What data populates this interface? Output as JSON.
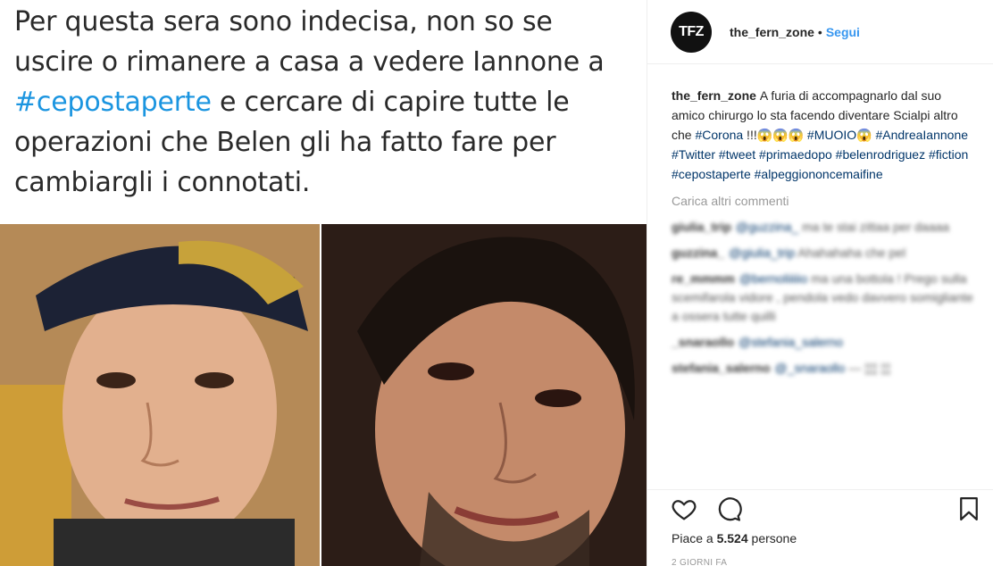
{
  "tweet": {
    "line1": "Per questa sera sono indecisa, non so se",
    "line2": "uscire o rimanere a casa a vedere Iannone a",
    "hashtag": "#cepostaperte",
    "line3_rest": " e cercare di capire tutte le",
    "line4": "operazioni che Belen gli ha fatto fare per",
    "line5": "cambiargli i connotati."
  },
  "header": {
    "avatar_text": "TFZ",
    "username": "the_fern_zone",
    "separator": "•",
    "follow_label": "Segui"
  },
  "caption": {
    "user": "the_fern_zone",
    "text1": "A furia di accompagnarlo dal suo amico chirurgo lo sta facendo diventare Scialpi altro che ",
    "tag_corona": "#Corona",
    "text2": " !!!😱😱😱 ",
    "tag_muoio": "#MUOIO",
    "text3": "😱 ",
    "tag_andrea": "#AndreaIannone",
    "tag_twitter": "#Twitter",
    "tag_tweet": "#tweet",
    "tag_primaedopo": "#primaedopo",
    "tag_belen": "#belenrodriguez",
    "tag_fiction": "#fiction",
    "tag_cepostaperte": "#cepostaperte",
    "tag_alpeggio": "#alpeggiononcemaifine"
  },
  "load_more_label": "Carica altri commenti",
  "blurred_comments": [
    {
      "user": "giulia_trip",
      "mention": "@guzzina_",
      "text": "ma te stai zittaa per daaaa"
    },
    {
      "user": "guzzina_",
      "mention": "@giulia_trip",
      "text": "Ahahahaha che pel"
    },
    {
      "user": "re_mmmm",
      "mention": "@bernoliiiiio",
      "text": "ma una bottola ! Prego sulla scemifarola vidore , pendola vedo davvero somigliante a ossera tutte quilli"
    },
    {
      "user": "_snaraollo",
      "mention": "@stefania_salerno",
      "text": ""
    },
    {
      "user": "stefania_salerno",
      "mention": "@_snaraollo",
      "text": "— ¦¦¦¦ ¦¦¦"
    }
  ],
  "actions": {
    "likes_prefix": "Piace a ",
    "likes_count": "5.524",
    "likes_suffix": " persone",
    "timestamp": "2 GIORNI FA"
  }
}
